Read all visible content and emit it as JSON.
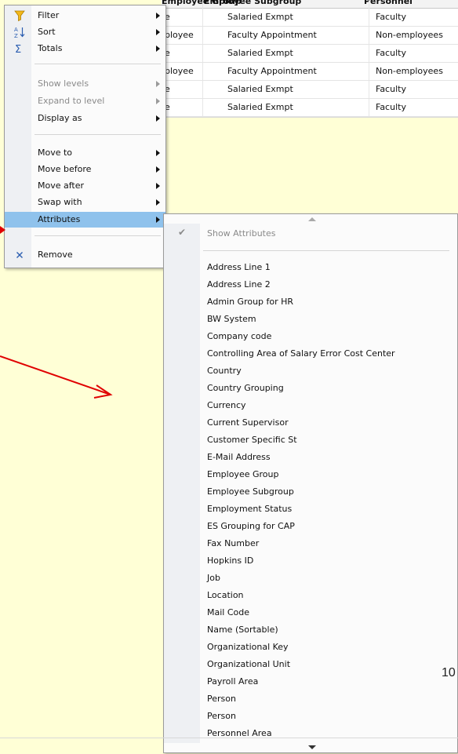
{
  "table": {
    "headers": [
      "Employee Group",
      "Employee Subgroup",
      "Personnel"
    ],
    "rows": [
      [
        "e",
        "Salaried Exmpt",
        "Faculty"
      ],
      [
        "ployee",
        "Faculty Appointment",
        "Non-employees"
      ],
      [
        "e",
        "Salaried Exmpt",
        "Faculty"
      ],
      [
        "ployee",
        "Faculty Appointment",
        "Non-employees"
      ],
      [
        "e",
        "Salaried Exmpt",
        "Faculty"
      ],
      [
        "e",
        "Salaried Exmpt",
        "Faculty"
      ]
    ]
  },
  "menu": {
    "items": [
      {
        "label": "Filter",
        "icon": "filter-icon"
      },
      {
        "label": "Sort",
        "icon": "sort-icon"
      },
      {
        "label": "Totals",
        "icon": "sigma-icon"
      },
      {
        "label": "Show levels"
      },
      {
        "label": "Expand to level"
      },
      {
        "label": "Display as"
      },
      {
        "label": "Move to"
      },
      {
        "label": "Move before"
      },
      {
        "label": "Move after"
      },
      {
        "label": "Swap with"
      },
      {
        "label": "Attributes"
      },
      {
        "label": "Remove",
        "icon": "close-icon"
      }
    ]
  },
  "submenu": {
    "show_attributes": "Show Attributes",
    "attributes": [
      "Address Line 1",
      "Address Line 2",
      "Admin Group for HR",
      "BW System",
      "Company code",
      "Controlling Area of Salary Error Cost Center",
      "Country",
      "Country Grouping",
      "Currency",
      "Current Supervisor",
      "Customer Specific St",
      "E-Mail Address",
      "Employee Group",
      "Employee Subgroup",
      "Employment Status",
      "ES Grouping for CAP",
      "Fax Number",
      "Hopkins ID",
      "Job",
      "Location",
      "Mail Code",
      "Name (Sortable)",
      "Organizational Key",
      "Organizational Unit",
      "Payroll Area",
      "Person",
      "Person",
      "Personnel Area"
    ]
  },
  "slide_number": "10",
  "colors": {
    "highlight": "#8fc2ec",
    "arrow": "#e00000",
    "background": "#ffffd6"
  }
}
